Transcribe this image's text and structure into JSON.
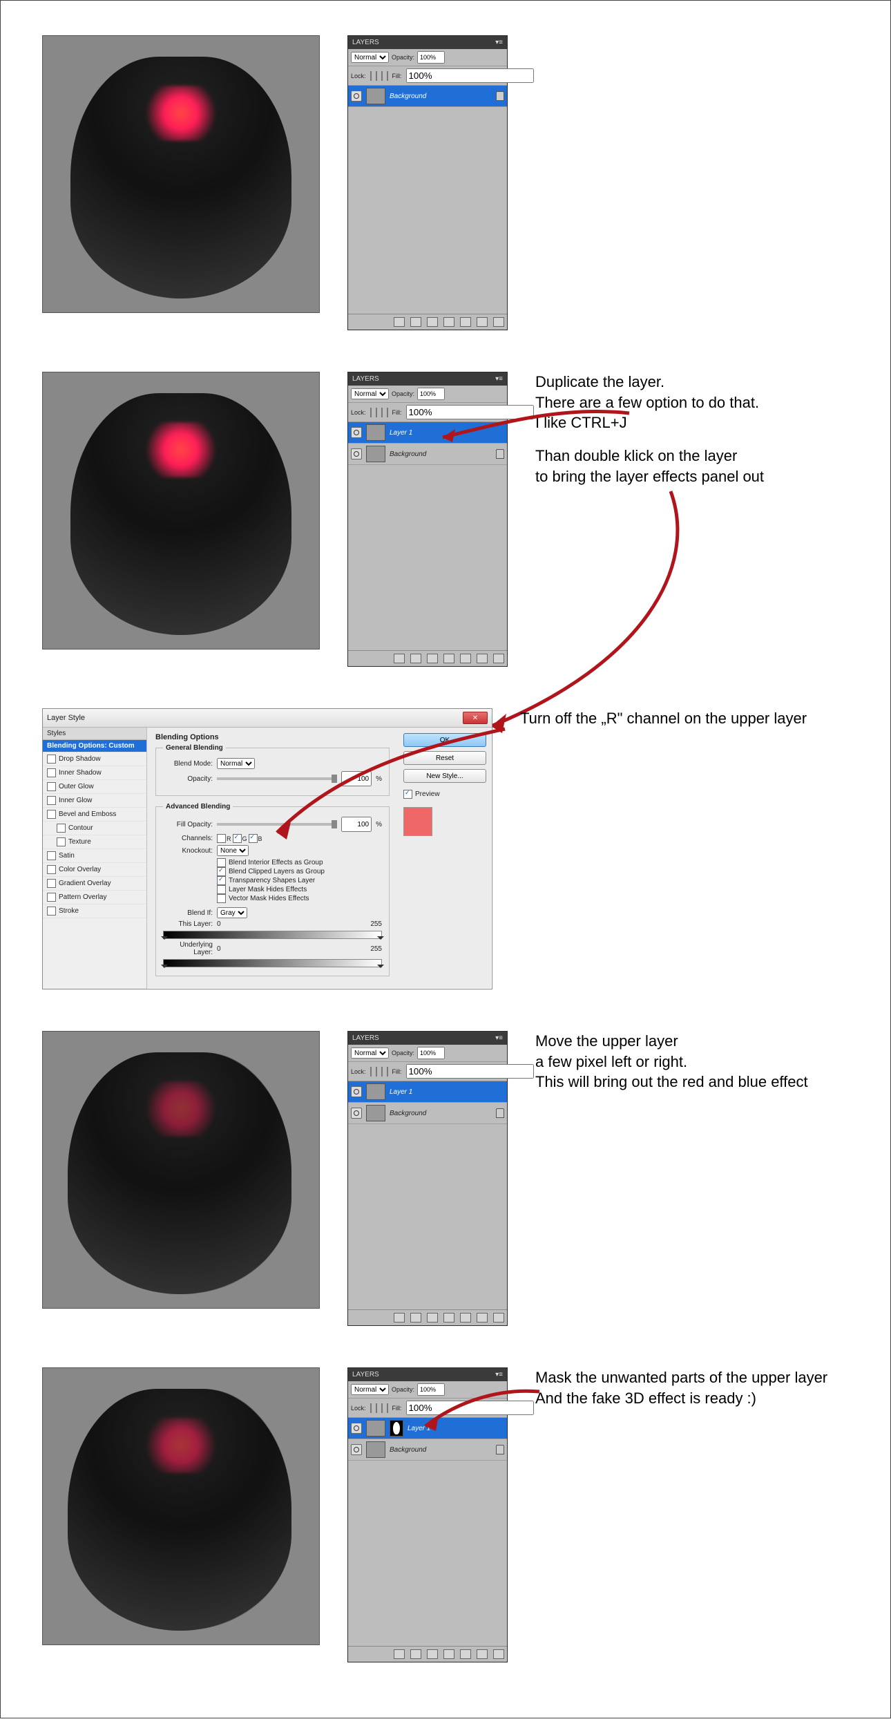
{
  "panel": {
    "title": "LAYERS",
    "blend_mode": "Normal",
    "opacity_label": "Opacity:",
    "opacity_value": "100%",
    "lock_label": "Lock:",
    "fill_label": "Fill:",
    "fill_value": "100%",
    "layer_background": "Background",
    "layer_dup": "Layer 1"
  },
  "step1": {},
  "step2": {
    "line1": "Duplicate the layer.",
    "line2": "There are a few option to do that.",
    "line3": "I like CTRL+J",
    "line4": "Than double klick on the layer",
    "line5": "to bring the layer effects panel out"
  },
  "step3": {
    "caption": "Turn off the „R\" channel on the upper layer"
  },
  "step4": {
    "line1": "Move the upper layer",
    "line2": "a few pixel left or right.",
    "line3": "This will bring out the red and blue effect"
  },
  "step5": {
    "line1": "Mask the unwanted parts of the upper layer",
    "line2": "And the fake 3D effect is ready :)"
  },
  "layerstyle": {
    "title": "Layer Style",
    "styles_header": "Styles",
    "blending_custom": "Blending Options: Custom",
    "items": {
      "drop_shadow": "Drop Shadow",
      "inner_shadow": "Inner Shadow",
      "outer_glow": "Outer Glow",
      "inner_glow": "Inner Glow",
      "bevel": "Bevel and Emboss",
      "contour": "Contour",
      "texture": "Texture",
      "satin": "Satin",
      "color_overlay": "Color Overlay",
      "gradient_overlay": "Gradient Overlay",
      "pattern_overlay": "Pattern Overlay",
      "stroke": "Stroke"
    },
    "section_title": "Blending Options",
    "general": "General Blending",
    "blend_mode_label": "Blend Mode:",
    "blend_mode_value": "Normal",
    "opacity_label": "Opacity:",
    "opacity_value": "100",
    "percent": "%",
    "advanced": "Advanced Blending",
    "fill_opacity_label": "Fill Opacity:",
    "fill_opacity_value": "100",
    "channels_label": "Channels:",
    "ch_r": "R",
    "ch_g": "G",
    "ch_b": "B",
    "knockout_label": "Knockout:",
    "knockout_value": "None",
    "chk1": "Blend Interior Effects as Group",
    "chk2": "Blend Clipped Layers as Group",
    "chk3": "Transparency Shapes Layer",
    "chk4": "Layer Mask Hides Effects",
    "chk5": "Vector Mask Hides Effects",
    "blendif_label": "Blend If:",
    "blendif_value": "Gray",
    "this_layer": "This Layer:",
    "underlying": "Underlying Layer:",
    "zero": "0",
    "max": "255",
    "btn_ok": "OK",
    "btn_reset": "Reset",
    "btn_newstyle": "New Style...",
    "preview_label": "Preview"
  }
}
